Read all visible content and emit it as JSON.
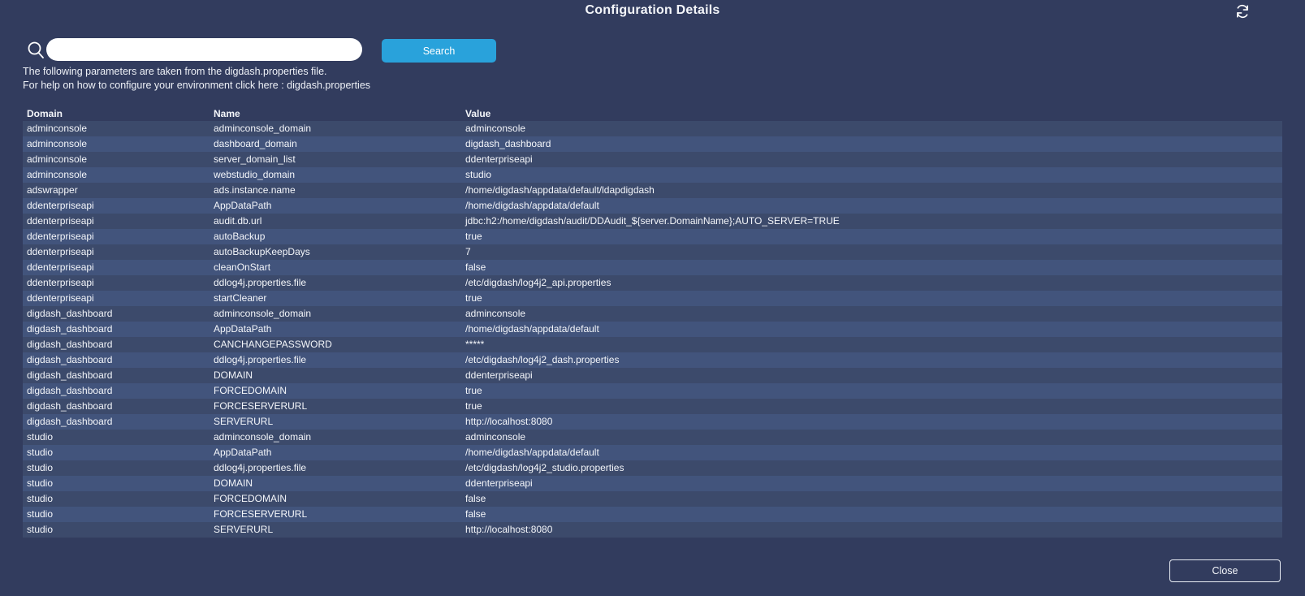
{
  "header": {
    "title": "Configuration Details"
  },
  "search": {
    "value": "",
    "placeholder": "",
    "button_label": "Search"
  },
  "info": {
    "line1": "The following parameters are taken from the digdash.properties file.",
    "line2_prefix": "For help on how to configure your environment click here : ",
    "line2_link": "digdash.properties"
  },
  "table": {
    "columns": [
      "Domain",
      "Name",
      "Value"
    ],
    "rows": [
      [
        "adminconsole",
        "adminconsole_domain",
        "adminconsole"
      ],
      [
        "adminconsole",
        "dashboard_domain",
        "digdash_dashboard"
      ],
      [
        "adminconsole",
        "server_domain_list",
        "ddenterpriseapi"
      ],
      [
        "adminconsole",
        "webstudio_domain",
        "studio"
      ],
      [
        "adswrapper",
        "ads.instance.name",
        "/home/digdash/appdata/default/ldapdigdash"
      ],
      [
        "ddenterpriseapi",
        "AppDataPath",
        "/home/digdash/appdata/default"
      ],
      [
        "ddenterpriseapi",
        "audit.db.url",
        "jdbc:h2:/home/digdash/audit/DDAudit_${server.DomainName};AUTO_SERVER=TRUE"
      ],
      [
        "ddenterpriseapi",
        "autoBackup",
        "true"
      ],
      [
        "ddenterpriseapi",
        "autoBackupKeepDays",
        "7"
      ],
      [
        "ddenterpriseapi",
        "cleanOnStart",
        "false"
      ],
      [
        "ddenterpriseapi",
        "ddlog4j.properties.file",
        "/etc/digdash/log4j2_api.properties"
      ],
      [
        "ddenterpriseapi",
        "startCleaner",
        "true"
      ],
      [
        "digdash_dashboard",
        "adminconsole_domain",
        "adminconsole"
      ],
      [
        "digdash_dashboard",
        "AppDataPath",
        "/home/digdash/appdata/default"
      ],
      [
        "digdash_dashboard",
        "CANCHANGEPASSWORD",
        "*****"
      ],
      [
        "digdash_dashboard",
        "ddlog4j.properties.file",
        "/etc/digdash/log4j2_dash.properties"
      ],
      [
        "digdash_dashboard",
        "DOMAIN",
        "ddenterpriseapi"
      ],
      [
        "digdash_dashboard",
        "FORCEDOMAIN",
        "true"
      ],
      [
        "digdash_dashboard",
        "FORCESERVERURL",
        "true"
      ],
      [
        "digdash_dashboard",
        "SERVERURL",
        "http://localhost:8080"
      ],
      [
        "studio",
        "adminconsole_domain",
        "adminconsole"
      ],
      [
        "studio",
        "AppDataPath",
        "/home/digdash/appdata/default"
      ],
      [
        "studio",
        "ddlog4j.properties.file",
        "/etc/digdash/log4j2_studio.properties"
      ],
      [
        "studio",
        "DOMAIN",
        "ddenterpriseapi"
      ],
      [
        "studio",
        "FORCEDOMAIN",
        "false"
      ],
      [
        "studio",
        "FORCESERVERURL",
        "false"
      ],
      [
        "studio",
        "SERVERURL",
        "http://localhost:8080"
      ]
    ]
  },
  "footer": {
    "close_label": "Close"
  },
  "colors": {
    "background": "#323c5e",
    "row_odd": "#3c4a6b",
    "row_even": "#42547c",
    "accent_blue": "#29a2db",
    "text": "#f4f6fa"
  }
}
